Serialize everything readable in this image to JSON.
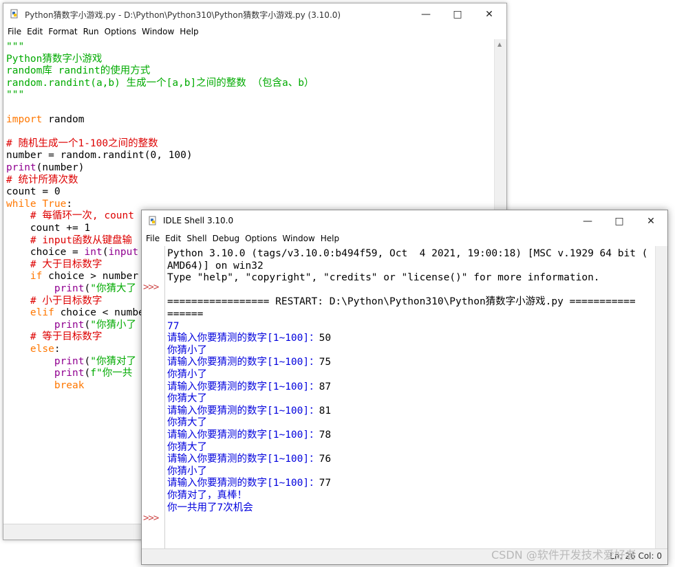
{
  "editor": {
    "title": "Python猜数字小游戏.py - D:\\Python\\Python310\\Python猜数字小游戏.py (3.10.0)",
    "menu": [
      "File",
      "Edit",
      "Format",
      "Run",
      "Options",
      "Window",
      "Help"
    ],
    "code": [
      [
        {
          "c": "str",
          "t": "\"\"\""
        }
      ],
      [
        {
          "c": "str",
          "t": "Python猜数字小游戏"
        }
      ],
      [
        {
          "c": "str",
          "t": "random库 randint的使用方式"
        }
      ],
      [
        {
          "c": "str",
          "t": "random.randint(a,b) 生成一个[a,b]之间的整数 （包含a、b）"
        }
      ],
      [
        {
          "c": "str",
          "t": "\"\"\""
        }
      ],
      [],
      [
        {
          "c": "kw",
          "t": "import"
        },
        {
          "c": "txt",
          "t": " random"
        }
      ],
      [],
      [
        {
          "c": "cmt",
          "t": "# 随机生成一个1-100之间的整数"
        }
      ],
      [
        {
          "c": "txt",
          "t": "number = random.randint(0, 100)"
        }
      ],
      [
        {
          "c": "bi",
          "t": "print"
        },
        {
          "c": "txt",
          "t": "(number)"
        }
      ],
      [
        {
          "c": "cmt",
          "t": "# 统计所猜次数"
        }
      ],
      [
        {
          "c": "txt",
          "t": "count = 0"
        }
      ],
      [
        {
          "c": "kw",
          "t": "while"
        },
        {
          "c": "txt",
          "t": " "
        },
        {
          "c": "kw",
          "t": "True"
        },
        {
          "c": "txt",
          "t": ":"
        }
      ],
      [
        {
          "c": "txt",
          "t": "    "
        },
        {
          "c": "cmt",
          "t": "# 每循环一次, count"
        }
      ],
      [
        {
          "c": "txt",
          "t": "    count += 1"
        }
      ],
      [
        {
          "c": "txt",
          "t": "    "
        },
        {
          "c": "cmt",
          "t": "# input函数从键盘输"
        }
      ],
      [
        {
          "c": "txt",
          "t": "    choice = "
        },
        {
          "c": "bi",
          "t": "int"
        },
        {
          "c": "txt",
          "t": "("
        },
        {
          "c": "bi",
          "t": "input"
        }
      ],
      [
        {
          "c": "txt",
          "t": "    "
        },
        {
          "c": "cmt",
          "t": "# 大于目标数字"
        }
      ],
      [
        {
          "c": "txt",
          "t": "    "
        },
        {
          "c": "kw",
          "t": "if"
        },
        {
          "c": "txt",
          "t": " choice > number"
        }
      ],
      [
        {
          "c": "txt",
          "t": "        "
        },
        {
          "c": "bi",
          "t": "print"
        },
        {
          "c": "txt",
          "t": "("
        },
        {
          "c": "str",
          "t": "\"你猜大了"
        }
      ],
      [
        {
          "c": "txt",
          "t": "    "
        },
        {
          "c": "cmt",
          "t": "# 小于目标数字"
        }
      ],
      [
        {
          "c": "txt",
          "t": "    "
        },
        {
          "c": "kw",
          "t": "elif"
        },
        {
          "c": "txt",
          "t": " choice < numbe"
        }
      ],
      [
        {
          "c": "txt",
          "t": "        "
        },
        {
          "c": "bi",
          "t": "print"
        },
        {
          "c": "txt",
          "t": "("
        },
        {
          "c": "str",
          "t": "\"你猜小了"
        }
      ],
      [
        {
          "c": "txt",
          "t": "    "
        },
        {
          "c": "cmt",
          "t": "# 等于目标数字"
        }
      ],
      [
        {
          "c": "txt",
          "t": "    "
        },
        {
          "c": "kw",
          "t": "else"
        },
        {
          "c": "txt",
          "t": ":"
        }
      ],
      [
        {
          "c": "txt",
          "t": "        "
        },
        {
          "c": "bi",
          "t": "print"
        },
        {
          "c": "txt",
          "t": "("
        },
        {
          "c": "str",
          "t": "\"你猜对了"
        }
      ],
      [
        {
          "c": "txt",
          "t": "        "
        },
        {
          "c": "bi",
          "t": "print"
        },
        {
          "c": "txt",
          "t": "("
        },
        {
          "c": "str",
          "t": "f\"你一共"
        }
      ],
      [
        {
          "c": "txt",
          "t": "        "
        },
        {
          "c": "kw",
          "t": "break"
        }
      ]
    ]
  },
  "shell": {
    "title": "IDLE Shell 3.10.0",
    "menu": [
      "File",
      "Edit",
      "Shell",
      "Debug",
      "Options",
      "Window",
      "Help"
    ],
    "prompt_glyph": ">>>",
    "output": [
      {
        "c": "txt",
        "t": "Python 3.10.0 (tags/v3.10.0:b494f59, Oct  4 2021, 19:00:18) [MSC v.1929 64 bit ("
      },
      {
        "c": "txt",
        "t": "AMD64)] on win32"
      },
      {
        "c": "txt",
        "t": "Type \"help\", \"copyright\", \"credits\" or \"license()\" for more information."
      },
      {
        "c": "txt",
        "t": ""
      },
      {
        "c": "txt",
        "t": "================= RESTART: D:\\Python\\Python310\\Python猜数字小游戏.py ==========="
      },
      {
        "c": "txt",
        "t": "======"
      },
      {
        "c": "blue",
        "t": "77"
      },
      {
        "c": "blue",
        "t": "请输入你要猜测的数字[1~100]：",
        "v": "50"
      },
      {
        "c": "blue",
        "t": "你猜小了"
      },
      {
        "c": "blue",
        "t": "请输入你要猜测的数字[1~100]：",
        "v": "75"
      },
      {
        "c": "blue",
        "t": "你猜小了"
      },
      {
        "c": "blue",
        "t": "请输入你要猜测的数字[1~100]：",
        "v": "87"
      },
      {
        "c": "blue",
        "t": "你猜大了"
      },
      {
        "c": "blue",
        "t": "请输入你要猜测的数字[1~100]：",
        "v": "81"
      },
      {
        "c": "blue",
        "t": "你猜大了"
      },
      {
        "c": "blue",
        "t": "请输入你要猜测的数字[1~100]：",
        "v": "78"
      },
      {
        "c": "blue",
        "t": "你猜大了"
      },
      {
        "c": "blue",
        "t": "请输入你要猜测的数字[1~100]：",
        "v": "76"
      },
      {
        "c": "blue",
        "t": "你猜小了"
      },
      {
        "c": "blue",
        "t": "请输入你要猜测的数字[1~100]：",
        "v": "77"
      },
      {
        "c": "blue",
        "t": "你猜对了，真棒！"
      },
      {
        "c": "blue",
        "t": "你一共用了7次机会"
      }
    ],
    "status": "Ln: 26 Col: 0"
  },
  "watermark": "CSDN @软件开发技术爱好者"
}
